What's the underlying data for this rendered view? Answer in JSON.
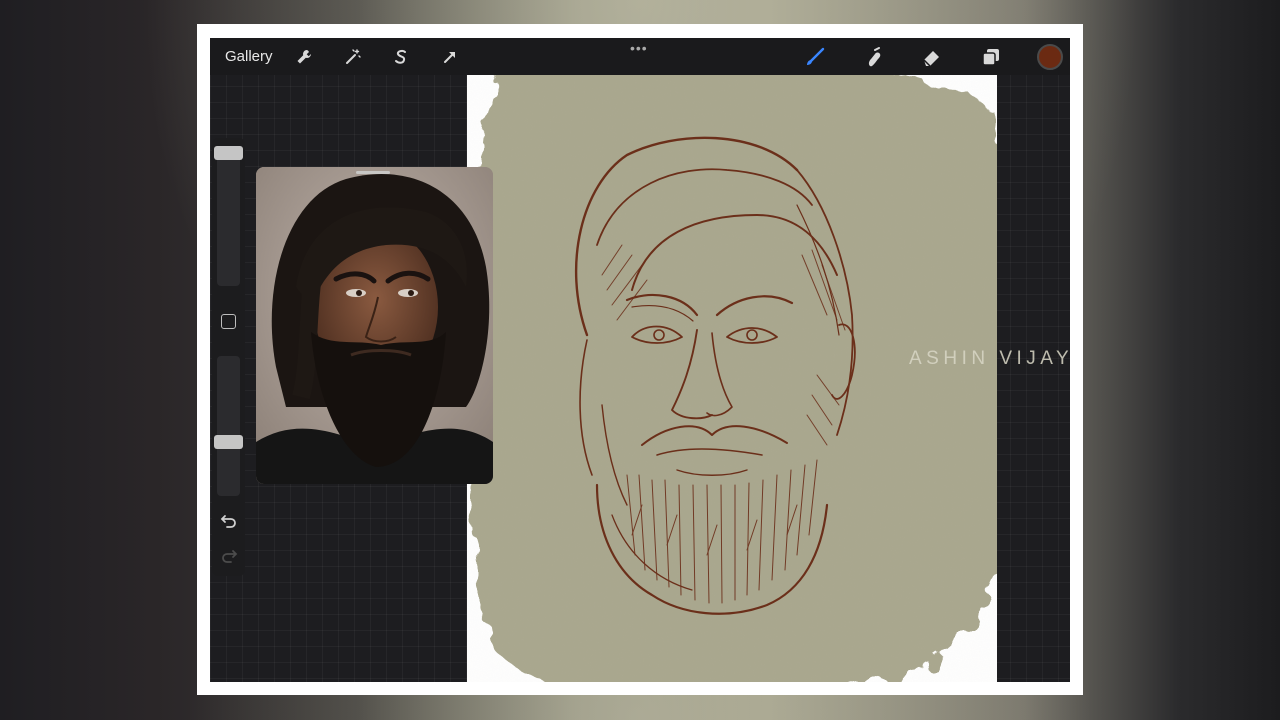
{
  "app": {
    "gallery_label": "Gallery",
    "more_menu_glyph": "•••",
    "current_color": "#6b2a12"
  },
  "toolbar_left": [
    {
      "name": "actions-wrench-icon"
    },
    {
      "name": "adjustments-magic-wand-icon"
    },
    {
      "name": "selection-s-icon"
    },
    {
      "name": "transform-arrow-icon"
    }
  ],
  "toolbar_right": [
    {
      "name": "brush-icon",
      "active": true,
      "color": "#3a86ff"
    },
    {
      "name": "smudge-icon"
    },
    {
      "name": "eraser-icon"
    },
    {
      "name": "layers-icon"
    }
  ],
  "watermark": "ASHIN VIJAY",
  "colors": {
    "canvas_bg": "#a9a78e",
    "sketch_stroke": "#6b2f1a",
    "ui_dark": "#1a1a1c",
    "accent_blue": "#3a86ff"
  }
}
